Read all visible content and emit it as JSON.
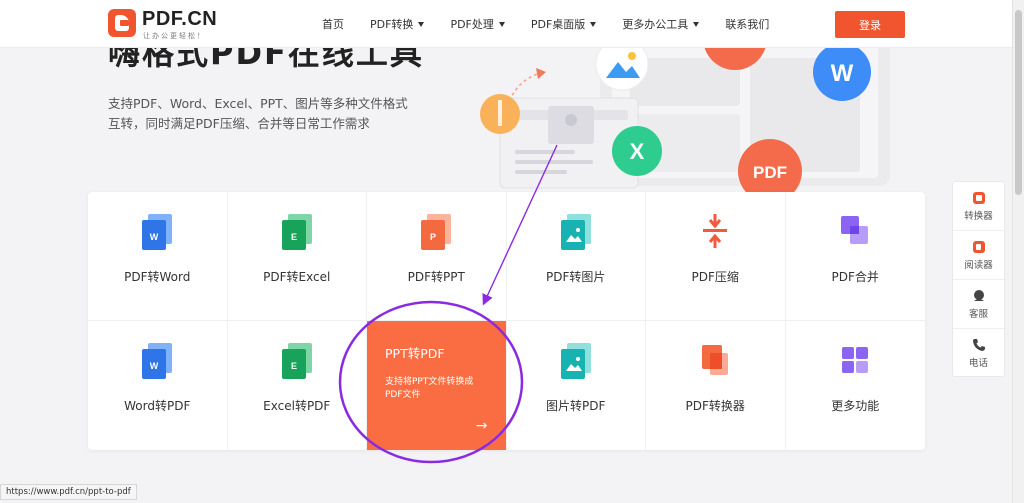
{
  "header": {
    "logo_text": "PDF.CN",
    "logo_sub": "让办公更轻松！",
    "nav": [
      {
        "label": "首页",
        "has_dropdown": false
      },
      {
        "label": "PDF转换",
        "has_dropdown": true
      },
      {
        "label": "PDF处理",
        "has_dropdown": true
      },
      {
        "label": "PDF桌面版",
        "has_dropdown": true
      },
      {
        "label": "更多办公工具",
        "has_dropdown": true
      },
      {
        "label": "联系我们",
        "has_dropdown": false
      }
    ],
    "login_label": "登录"
  },
  "hero": {
    "title": "嗨格式PDF在线工具",
    "desc_line1": "支持PDF、Word、Excel、PPT、图片等多种文件格式",
    "desc_line2": "互转，同时满足PDF压缩、合并等日常工作需求",
    "art_icons": [
      "W",
      "X",
      "PDF"
    ]
  },
  "tools": [
    {
      "label": "PDF转Word",
      "icon": "word-icon"
    },
    {
      "label": "PDF转Excel",
      "icon": "excel-icon"
    },
    {
      "label": "PDF转PPT",
      "icon": "ppt-icon"
    },
    {
      "label": "PDF转图片",
      "icon": "image-icon"
    },
    {
      "label": "PDF压缩",
      "icon": "compress-icon"
    },
    {
      "label": "PDF合并",
      "icon": "merge-icon"
    },
    {
      "label": "Word转PDF",
      "icon": "word-icon"
    },
    {
      "label": "Excel转PDF",
      "icon": "excel-icon"
    },
    {
      "label": "PPT转PDF",
      "icon": "ppt-icon",
      "active": true,
      "desc": "支持将PPT文件转换成PDF文件",
      "arrow": "→"
    },
    {
      "label": "图片转PDF",
      "icon": "image-icon"
    },
    {
      "label": "PDF转换器",
      "icon": "converter-icon"
    },
    {
      "label": "更多功能",
      "icon": "more-icon"
    }
  ],
  "side": [
    {
      "label": "转换器",
      "icon": "converter-icon"
    },
    {
      "label": "阅读器",
      "icon": "reader-icon"
    },
    {
      "label": "客服",
      "icon": "service-icon"
    },
    {
      "label": "电话",
      "icon": "phone-icon"
    }
  ],
  "status_url": "https://www.pdf.cn/ppt-to-pdf",
  "colors": {
    "accent": "#f0552f",
    "active_tile": "#fa6d42",
    "annotation": "#8a2be2"
  }
}
